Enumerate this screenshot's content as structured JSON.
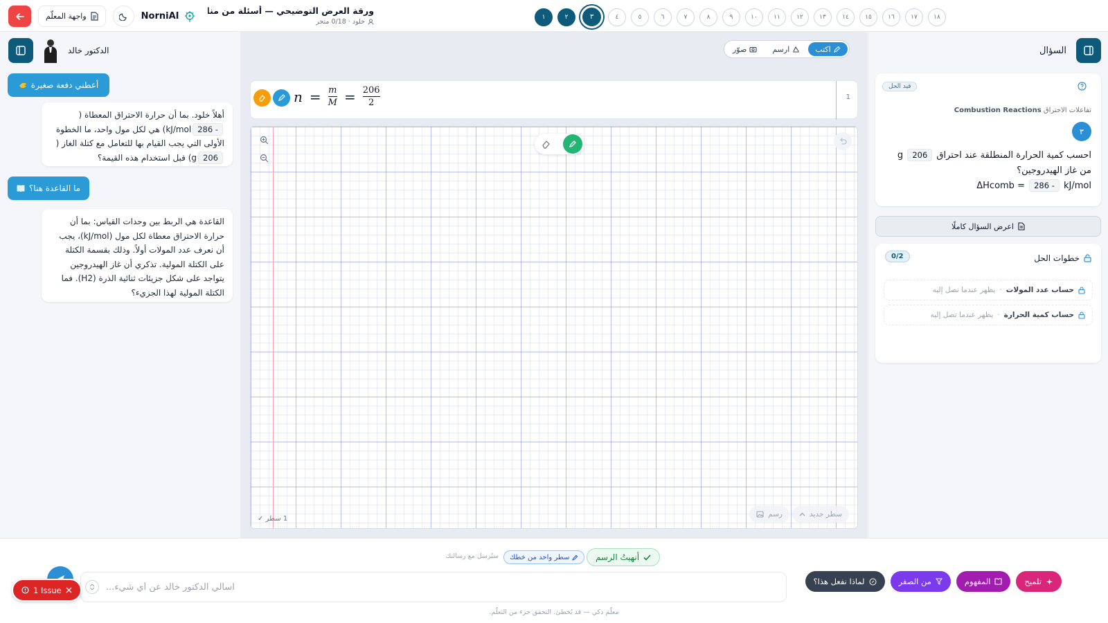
{
  "colors": {
    "primary": "#0e5a7a",
    "accent_blue": "#2b8fd6",
    "danger": "#dc2626",
    "success": "#22b573",
    "purple": "#a21caf",
    "violet": "#7c3aed"
  },
  "header": {
    "teacher_label": "واجهة المعلّم",
    "brand_norni": "Norni",
    "brand_ai": "AI",
    "title": "ورقة العرض التوضيحي — أسئلة من مناهج ...",
    "subtitle": "خلود · 0/18 متجر",
    "questions": [
      "١",
      "٢",
      "٣",
      "٤",
      "٥",
      "٦",
      "٧",
      "٨",
      "٩",
      "١٠",
      "١١",
      "١٢",
      "١٣",
      "١٤",
      "١٥",
      "١٦",
      "١٧",
      "١٨"
    ],
    "current_question_index": 2,
    "completed_count": 2
  },
  "chat": {
    "doctor_name": "الدكتور خالد",
    "nudge_button": "أعطني دفعة صغيرة",
    "msg1": {
      "part1": "أهلاً خلود. بما أن حرارة الاحتراق المعطاة (",
      "num1": "286 -",
      "part2": "kJ/mol) هي لكل مول واحد، ما الخطوة الأولى التي يجب القيام بها للتعامل مع كتلة الغاز (",
      "num2": "206",
      "part3": "g) قبل استخدام هذه القيمة؟"
    },
    "rule_button": "ما القاعدة هنا؟",
    "msg2": "القاعدة هي الربط بين وحدات القياس: بما أن حرارة الاحتراق معطاة لكل مول (kJ/mol)، يجب أن نعرف عدد المولات أولاً. وذلك بقسمة الكتلة على الكتلة المولية. تذكري أن غاز الهيدروجين يتواجد على شكل جزيئات ثنائية الذرة (H2). فما الكتلة المولية لهذا الجزيء؟"
  },
  "workspace": {
    "modes": [
      {
        "label": "اكتب",
        "icon": "pencil-icon",
        "active": true
      },
      {
        "label": "ارسم",
        "icon": "draw-icon",
        "active": false
      },
      {
        "label": "صوّر",
        "icon": "camera-icon",
        "active": false
      }
    ],
    "line_number": "1",
    "formula": {
      "lhs": "n",
      "eq": "=",
      "num1": "m",
      "den1": "M",
      "num2": "206",
      "den2": "2"
    },
    "line_count_label": "1 سطر ✓",
    "new_line_label": "سطر جديد",
    "draw_label": "رسم"
  },
  "question_panel": {
    "title": "السؤال",
    "status_tag": "قيد الحل",
    "topic_ar": "تفاعلات الاحتراق",
    "topic_en": "Combustion Reactions",
    "number": "٣",
    "text_part1": "احسب كمية الحرارة المنطلقة عند احتراق",
    "mass_value": "206",
    "mass_unit": "g",
    "text_part2": "من غاز الهيدروجين؟",
    "dh_label": "ΔHcomb =",
    "dh_value": "286 -",
    "dh_unit": "kJ/mol",
    "show_full_label": "اعرض السؤال كاملًا",
    "steps_title": "خطوات الحل",
    "steps_progress": "0/2",
    "steps": [
      {
        "label": "حساب عدد المولات",
        "hint": "يظهر عندما تصل إليه"
      },
      {
        "label": "حساب كمية الحرارة",
        "hint": "يظهر عندما تصل إليه"
      }
    ]
  },
  "bottom": {
    "finish_drawing": "أنهيتُ الرسم",
    "one_line_chip": "سطر واحد من خطك",
    "will_send_note": "سيُرسل مع رسالتك",
    "input_placeholder": "اسألي الدكتور خالد عن أي شيء...",
    "actions": [
      {
        "label": "تلميح",
        "icon": "sparkle-icon",
        "color": "#d9267a"
      },
      {
        "label": "المفهوم",
        "icon": "book-icon",
        "color": "#a21caf"
      },
      {
        "label": "من الصفر",
        "icon": "funnel-icon",
        "color": "#7c3aed"
      },
      {
        "label": "لماذا نفعل هذا؟",
        "icon": "compass-icon",
        "color": "#374151"
      }
    ],
    "issue_label": "1 Issue",
    "disclaimer": "معلّم ذكي — قد يُخطئ. التحقق جزء من التعلّم."
  }
}
